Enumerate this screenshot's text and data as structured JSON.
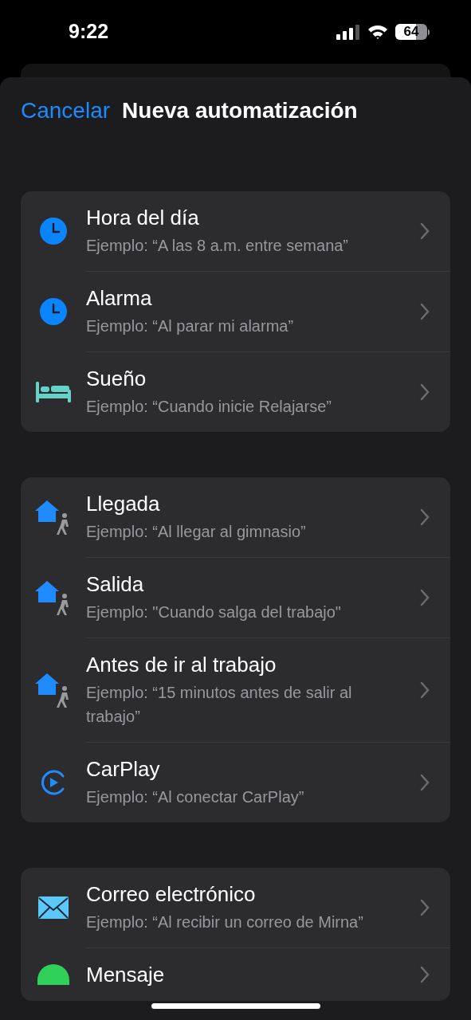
{
  "status_bar": {
    "time": "9:22",
    "battery": "64"
  },
  "header": {
    "cancel": "Cancelar",
    "title": "Nueva automatización"
  },
  "groups": [
    {
      "items": [
        {
          "kind": "clock",
          "title": "Hora del día",
          "subtitle": "Ejemplo: “A las 8 a.m. entre semana”"
        },
        {
          "kind": "clock",
          "title": "Alarma",
          "subtitle": "Ejemplo: “Al parar mi alarma”"
        },
        {
          "kind": "bed",
          "title": "Sueño",
          "subtitle": "Ejemplo: “Cuando inicie Relajarse”"
        }
      ]
    },
    {
      "items": [
        {
          "kind": "home-walk",
          "title": "Llegada",
          "subtitle": "Ejemplo: “Al llegar al gimnasio”"
        },
        {
          "kind": "home-walk",
          "title": "Salida",
          "subtitle": "Ejemplo: \"Cuando salga del trabajo\""
        },
        {
          "kind": "home-walk",
          "title": "Antes de ir al trabajo",
          "subtitle": "Ejemplo: “15 minutos antes de salir al trabajo”"
        },
        {
          "kind": "carplay",
          "title": "CarPlay",
          "subtitle": "Ejemplo: “Al conectar CarPlay”"
        }
      ]
    },
    {
      "items": [
        {
          "kind": "mail",
          "title": "Correo electrónico",
          "subtitle": "Ejemplo: “Al recibir un correo de Mirna”"
        },
        {
          "kind": "message",
          "title": "Mensaje"
        }
      ]
    }
  ]
}
